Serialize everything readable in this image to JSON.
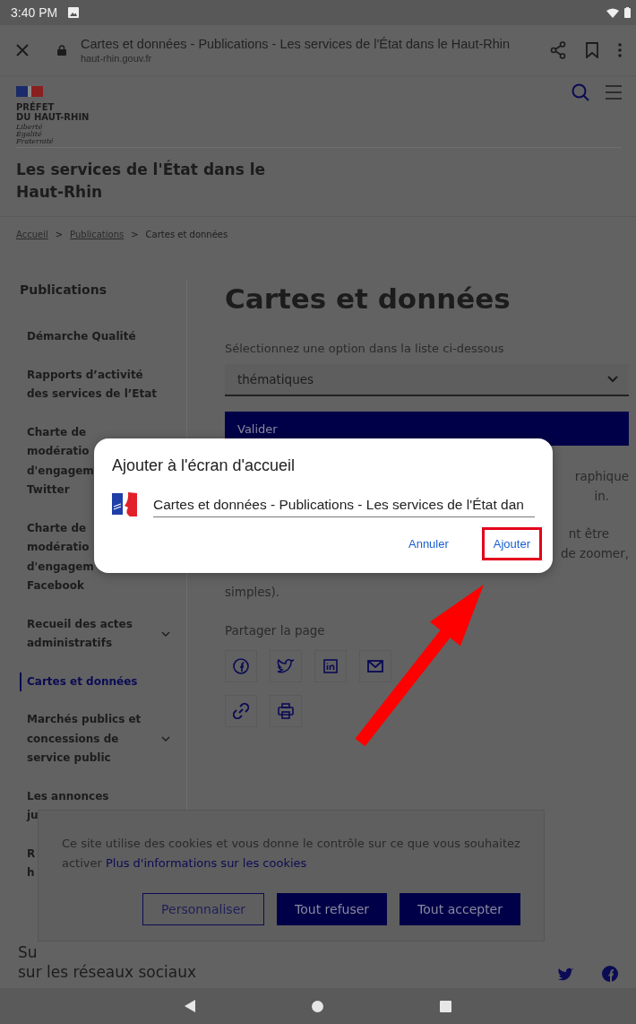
{
  "status_bar": {
    "time": "3:40 PM"
  },
  "browser": {
    "title": "Cartes et données - Publications - Les services de l'État dans le Haut-Rhin",
    "url": "haut-rhin.gouv.fr"
  },
  "header": {
    "logo_lines": [
      "PRÉFET",
      "DU HAUT-RHIN"
    ],
    "motto": [
      "Liberté",
      "Égalité",
      "Fraternité"
    ],
    "site_title_lines": [
      "Les services de l'État dans le",
      "Haut-Rhin"
    ]
  },
  "breadcrumb": [
    {
      "label": "Accueil",
      "link": true
    },
    {
      "prefix": ">",
      "label": "Publications",
      "link": true
    },
    {
      "prefix": ">",
      "label": "Cartes et données",
      "link": false
    }
  ],
  "sidebar": {
    "title": "Publications",
    "items": [
      {
        "lines": [
          "Démarche Qualité"
        ],
        "selected": false,
        "expandable": false
      },
      {
        "lines": [
          "Rapports d’activité",
          "des services de l’Etat"
        ],
        "selected": false,
        "expandable": false
      },
      {
        "lines": [
          "Charte de",
          "modératio",
          "d'engagem",
          "Twitter"
        ],
        "selected": false,
        "expandable": false
      },
      {
        "lines": [
          "Charte de",
          "modératio",
          "d'engagem",
          "Facebook"
        ],
        "selected": false,
        "expandable": false
      },
      {
        "lines": [
          "Recueil des actes",
          "administratifs"
        ],
        "selected": false,
        "expandable": true
      },
      {
        "lines": [
          "Cartes et données"
        ],
        "selected": true,
        "expandable": false
      },
      {
        "lines": [
          "Marchés publics et",
          "concessions de",
          "service public"
        ],
        "selected": false,
        "expandable": true
      },
      {
        "lines": [
          "Les annonces",
          "ju"
        ],
        "selected": false,
        "expandable": false
      },
      {
        "lines": [
          "R",
          "h"
        ],
        "selected": false,
        "expandable": false
      }
    ]
  },
  "main": {
    "title": "Cartes et données",
    "select_label": "Sélectionnez une option dans la liste ci-dessous",
    "select_value": "thématiques",
    "submit": "Valider",
    "text_fragments": [
      {
        "text": "raphique",
        "kind": "end"
      },
      {
        "text": "in.",
        "kind": "inset"
      },
      {
        "text": "nt être",
        "kind": "inset"
      },
      {
        "text": "de zoomer,",
        "kind": "end"
      },
      {
        "text": "simples).",
        "kind": "start"
      }
    ],
    "share_label": "Partager la page"
  },
  "footer": {
    "lines": [
      "Su",
      "sur les réseaux sociaux"
    ]
  },
  "cookie_banner": {
    "text": "Ce site utilise des cookies et vous donne le contrôle sur ce que vous souhaitez activer",
    "link": "Plus d'informations sur les cookies",
    "buttons": [
      {
        "label": "Personnaliser",
        "kind": "outline"
      },
      {
        "label": "Tout refuser",
        "kind": "filled"
      },
      {
        "label": "Tout accepter",
        "kind": "filled"
      }
    ]
  },
  "dialog": {
    "title": "Ajouter à l'écran d'accueil",
    "value": "Cartes et données - Publications - Les services de l'État dan",
    "buttons": [
      {
        "label": "Annuler",
        "highlighted": false
      },
      {
        "label": "Ajouter",
        "highlighted": true
      }
    ]
  },
  "annotation_arrow": true
}
